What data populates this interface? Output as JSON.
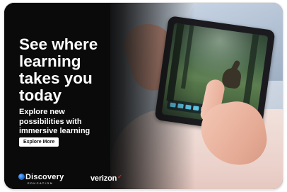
{
  "ad": {
    "headline": "See where\nlearning\ntakes you\ntoday",
    "subheadline": "Explore new\npossibilities with\nimmersive learning",
    "cta_label": "Explore More"
  },
  "brands": {
    "discovery_word": "Discovery",
    "discovery_sub": "EDUCATION",
    "verizon_word": "verizon"
  },
  "colors": {
    "background": "#0a0a0a",
    "text": "#ffffff",
    "cta_bg": "#ffffff",
    "verizon_check": "#e2231a",
    "tablet_ui_accent": "#5dc5e6"
  },
  "icons": {
    "verizon_check": "checkmark"
  }
}
